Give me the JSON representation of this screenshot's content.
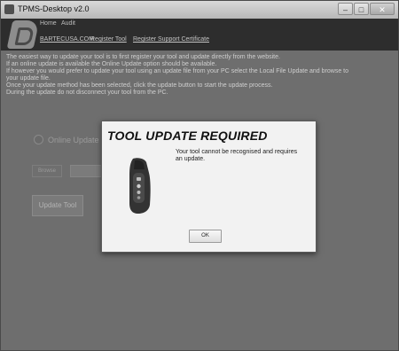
{
  "window": {
    "title": "TPMS-Desktop v2.0",
    "controls": {
      "minimize": "–",
      "maximize": "□",
      "close": "✕"
    }
  },
  "menu": {
    "home": "Home",
    "audit": "Audit"
  },
  "links": {
    "brand": "BARTECUSA.COM",
    "register_tool": "Register Tool",
    "register_support_certificate": "Register Support Certificate"
  },
  "instructions": {
    "line1": "The easiest way to update your tool is to first register your tool and update directly from the website.",
    "line2": "If an online update is available the Online Update option should be available.",
    "line3": "If however you would prefer to update your tool using an update file from your PC select the Local File Update and browse to",
    "line4": "your update file.",
    "line5": "Once your update method has been selected, click the update button to start the update process.",
    "line6": "During the update do not disconnect your tool from the PC."
  },
  "form": {
    "online_update_label": "Online Update",
    "browse_label": "Browse",
    "update_tool_button": "Update Tool"
  },
  "dialog": {
    "title": "TOOL UPDATE REQUIRED",
    "message": "Your tool cannot be recognised and requires an update.",
    "ok_label": "OK",
    "icon": "tpms-tool-device-icon"
  }
}
